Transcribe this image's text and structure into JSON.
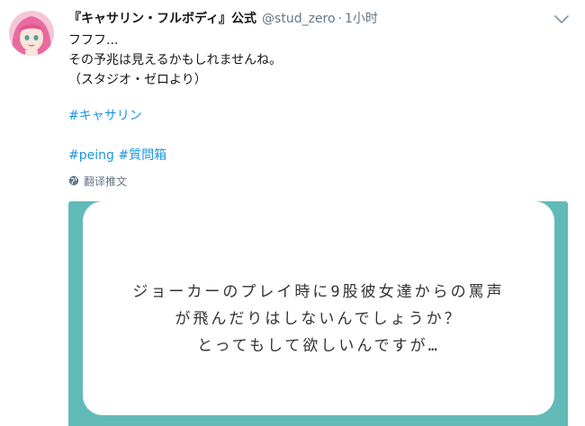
{
  "tweet": {
    "display_name": "『キャサリン・フルボディ』公式",
    "handle": "@stud_zero",
    "separator": "·",
    "time": "1小时",
    "text_lines": [
      "フフフ...",
      "その予兆は見えるかもしれませんね。",
      "（スタジオ・ゼロより）"
    ],
    "hashtag1": "#キャサリン",
    "hashtag2_a": "#peing",
    "hashtag2_b": "#質問箱",
    "translate_label": "翻译推文"
  },
  "media": {
    "question_lines": [
      "ジョーカーのプレイ時に9股彼女達からの罵声",
      "が飛んだりはしないんでしょうか？",
      "とってもして欲しいんですが…"
    ]
  },
  "colors": {
    "link": "#1b95e0",
    "secondary_text": "#657786",
    "card_teal": "#62bab8",
    "avatar_hair": "#e96aa0"
  },
  "icons": {
    "caret": "chevron-down-icon",
    "translate": "globe-icon"
  }
}
